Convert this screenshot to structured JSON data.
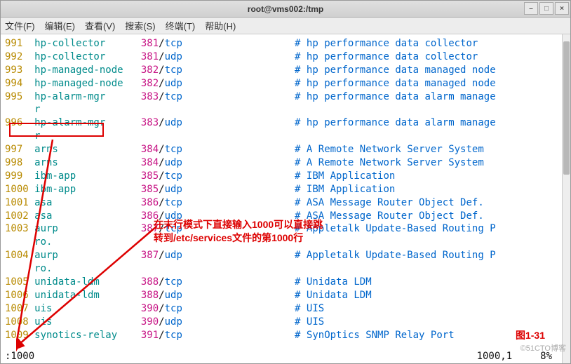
{
  "window": {
    "title": "root@vms002:/tmp",
    "controls": {
      "min": "–",
      "max": "□",
      "close": "×"
    }
  },
  "menu": {
    "file": "文件(F)",
    "edit": "编辑(E)",
    "view": "查看(V)",
    "search": "搜索(S)",
    "terminal": "终端(T)",
    "help": "帮助(H)"
  },
  "status": {
    "left": ":1000",
    "pos": "1000,1",
    "pct": "8%"
  },
  "overlay": {
    "note_line1": "在末行模式下直接输入1000可以直接跳",
    "note_line2": "转到/etc/services文件的第1000行",
    "fig": "图1-31",
    "watermark": "©51CTO博客"
  },
  "lines": [
    {
      "ln": "991",
      "svc": "hp-collector",
      "port": "381",
      "proto": "tcp",
      "cmt": "hp performance data collector"
    },
    {
      "ln": "992",
      "svc": "hp-collector",
      "port": "381",
      "proto": "udp",
      "cmt": "hp performance data collector"
    },
    {
      "ln": "993",
      "svc": "hp-managed-node",
      "port": "382",
      "proto": "tcp",
      "cmt": "hp performance data managed node"
    },
    {
      "ln": "994",
      "svc": "hp-managed-node",
      "port": "382",
      "proto": "udp",
      "cmt": "hp performance data managed node"
    },
    {
      "ln": "995",
      "svc": "hp-alarm-mgr",
      "port": "383",
      "proto": "tcp",
      "cmt": "hp performance data alarm manage"
    },
    {
      "ln": "",
      "svc": "r",
      "port": "",
      "proto": "",
      "cmt": ""
    },
    {
      "ln": "996",
      "svc": "hp-alarm-mgr",
      "port": "383",
      "proto": "udp",
      "cmt": "hp performance data alarm manage"
    },
    {
      "ln": "",
      "svc": "r",
      "port": "",
      "proto": "",
      "cmt": ""
    },
    {
      "ln": "997",
      "svc": "arns",
      "port": "384",
      "proto": "tcp",
      "cmt": "A Remote Network Server System"
    },
    {
      "ln": "998",
      "svc": "arns",
      "port": "384",
      "proto": "udp",
      "cmt": "A Remote Network Server System"
    },
    {
      "ln": "999",
      "svc": "ibm-app",
      "port": "385",
      "proto": "tcp",
      "cmt": "IBM Application"
    },
    {
      "ln": "1000",
      "svc": "ibm-app",
      "port": "385",
      "proto": "udp",
      "cmt": "IBM Application"
    },
    {
      "ln": "1001",
      "svc": "asa",
      "port": "386",
      "proto": "tcp",
      "cmt": "ASA Message Router Object Def."
    },
    {
      "ln": "1002",
      "svc": "asa",
      "port": "386",
      "proto": "udp",
      "cmt": "ASA Message Router Object Def."
    },
    {
      "ln": "1003",
      "svc": "aurp",
      "port": "387",
      "proto": "tcp",
      "cmt": "Appletalk Update-Based Routing P"
    },
    {
      "ln": "",
      "svc": "ro.",
      "port": "",
      "proto": "",
      "cmt": ""
    },
    {
      "ln": "1004",
      "svc": "aurp",
      "port": "387",
      "proto": "udp",
      "cmt": "Appletalk Update-Based Routing P"
    },
    {
      "ln": "",
      "svc": "ro.",
      "port": "",
      "proto": "",
      "cmt": ""
    },
    {
      "ln": "1005",
      "svc": "unidata-ldm",
      "port": "388",
      "proto": "tcp",
      "cmt": "Unidata LDM"
    },
    {
      "ln": "1006",
      "svc": "unidata-ldm",
      "port": "388",
      "proto": "udp",
      "cmt": "Unidata LDM"
    },
    {
      "ln": "1007",
      "svc": "uis",
      "port": "390",
      "proto": "tcp",
      "cmt": "UIS"
    },
    {
      "ln": "1008",
      "svc": "uis",
      "port": "390",
      "proto": "udp",
      "cmt": "UIS"
    },
    {
      "ln": "1009",
      "svc": "synotics-relay",
      "port": "391",
      "proto": "tcp",
      "cmt": "SynOptics SNMP Relay Port"
    }
  ]
}
